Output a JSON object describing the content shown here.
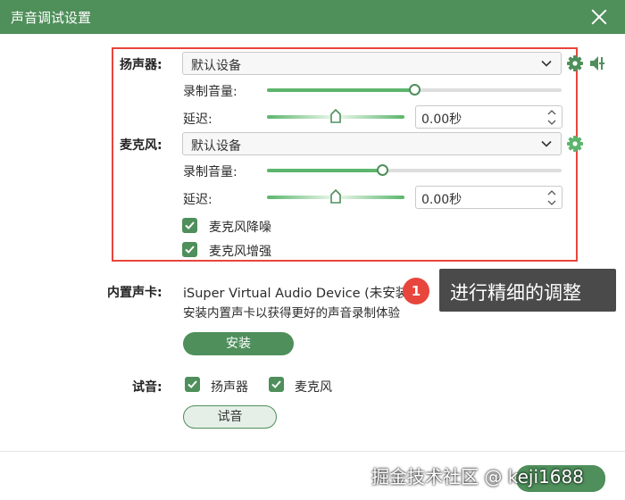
{
  "window": {
    "title": "声音调试设置"
  },
  "speaker": {
    "label": "扬声器:",
    "device": "默认设备",
    "volume_label": "录制音量:",
    "volume_level": 0.5,
    "delay_label": "延迟:",
    "delay_value": "0.00秒",
    "delay_level": 0.5
  },
  "microphone": {
    "label": "麦克风:",
    "device": "默认设备",
    "volume_label": "录制音量:",
    "volume_level": 0.39,
    "delay_label": "延迟:",
    "delay_value": "0.00秒",
    "delay_level": 0.5,
    "noise_reduction": {
      "label": "麦克风降噪",
      "checked": true
    },
    "enhance": {
      "label": "麦克风增强",
      "checked": true
    }
  },
  "builtin": {
    "label": "内置声卡:",
    "device_name": "iSuper Virtual Audio Device (未安装)",
    "description": "安装内置声卡以获得更好的声音录制体验",
    "install_label": "安装"
  },
  "test": {
    "label": "试音:",
    "speaker_label": "扬声器",
    "speaker_checked": true,
    "mic_label": "麦克风",
    "mic_checked": true,
    "button_label": "试音"
  },
  "annotation": {
    "badge": "1",
    "text": "进行精细的调整"
  },
  "watermark": "掘金技术社区 @ keji1688",
  "colors": {
    "accent": "#4e8f5b",
    "titlebar": "#4f8f5a",
    "highlight": "#e8453c",
    "slider_fill": "#5cb56c"
  }
}
